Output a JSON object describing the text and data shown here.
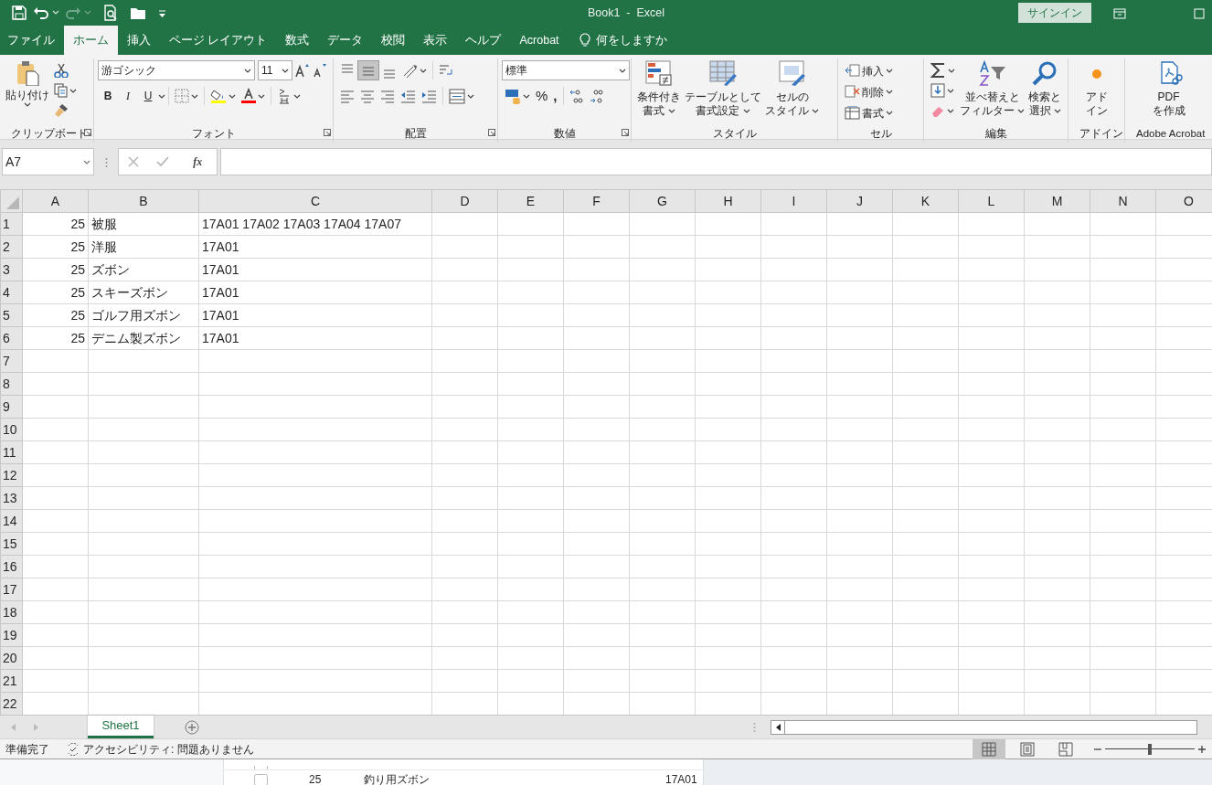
{
  "window": {
    "title": "Book1  -  Excel",
    "sign_in": "サインイン"
  },
  "tabs": [
    {
      "label": "ファイル",
      "selected": false
    },
    {
      "label": "ホーム",
      "selected": true
    },
    {
      "label": "挿入",
      "selected": false
    },
    {
      "label": "ページ レイアウト",
      "selected": false
    },
    {
      "label": "数式",
      "selected": false
    },
    {
      "label": "データ",
      "selected": false
    },
    {
      "label": "校閲",
      "selected": false
    },
    {
      "label": "表示",
      "selected": false
    },
    {
      "label": "ヘルプ",
      "selected": false
    },
    {
      "label": "Acrobat",
      "selected": false
    }
  ],
  "tell_me": "何をしますか",
  "ribbon": {
    "groups": [
      {
        "label": "クリップボード",
        "launcher": true,
        "buttons": [
          {
            "lines": [
              "貼り付け"
            ]
          }
        ]
      },
      {
        "label": "フォント",
        "launcher": true,
        "font_name": "游ゴシック",
        "font_size": "11",
        "buttons": [
          "B",
          "I",
          "U"
        ]
      },
      {
        "label": "配置",
        "launcher": true,
        "align_buttons": [
          {
            "selected": false
          },
          {
            "selected": true
          },
          {
            "selected": false
          }
        ]
      },
      {
        "label": "数値",
        "launcher": true,
        "format": "標準",
        "symbols": [
          "%",
          ","
        ]
      },
      {
        "label": "スタイル",
        "launcher": false,
        "buttons": [
          {
            "lines": [
              "条件付き",
              "書式"
            ]
          },
          {
            "lines": [
              "テーブルとして",
              "書式設定"
            ]
          },
          {
            "lines": [
              "セルの",
              "スタイル"
            ]
          }
        ]
      },
      {
        "label": "セル",
        "launcher": false,
        "buttons": [
          {
            "lines": [
              "挿入"
            ]
          },
          {
            "lines": [
              "削除"
            ]
          },
          {
            "lines": [
              "書式"
            ]
          }
        ]
      },
      {
        "label": "編集",
        "launcher": false,
        "buttons": [
          {
            "lines": [
              "並べ替えと",
              "フィルター"
            ]
          },
          {
            "lines": [
              "検索と",
              "選択"
            ]
          }
        ]
      },
      {
        "label": "アドイン",
        "launcher": false,
        "buttons": [
          {
            "lines": [
              "アド",
              "イン"
            ]
          }
        ]
      },
      {
        "label": "Adobe Acrobat",
        "launcher": false,
        "buttons": [
          {
            "lines": [
              "PDF",
              "を作成"
            ]
          }
        ]
      }
    ]
  },
  "formula_bar": {
    "name_box": "A7",
    "function_label": "fx"
  },
  "table": {
    "columns": [
      "A",
      "B",
      "C",
      "D",
      "E",
      "F",
      "G",
      "H",
      "I",
      "J",
      "K",
      "L",
      "M",
      "N",
      "O"
    ],
    "rows": [
      {
        "num": "1",
        "cells": [
          "25",
          "被服",
          "17A01 17A02 17A03 17A04 17A07"
        ]
      },
      {
        "num": "2",
        "cells": [
          "25",
          "洋服",
          "17A01"
        ]
      },
      {
        "num": "3",
        "cells": [
          "25",
          "ズボン",
          "17A01"
        ]
      },
      {
        "num": "4",
        "cells": [
          "25",
          "スキーズボン",
          "17A01"
        ]
      },
      {
        "num": "5",
        "cells": [
          "25",
          "ゴルフ用ズボン",
          "17A01"
        ]
      },
      {
        "num": "6",
        "cells": [
          "25",
          "デニム製ズボン",
          "17A01"
        ]
      },
      {
        "num": "7",
        "cells": []
      },
      {
        "num": "8",
        "cells": []
      },
      {
        "num": "9",
        "cells": []
      },
      {
        "num": "10",
        "cells": []
      },
      {
        "num": "11",
        "cells": []
      },
      {
        "num": "12",
        "cells": []
      },
      {
        "num": "13",
        "cells": []
      },
      {
        "num": "14",
        "cells": []
      },
      {
        "num": "15",
        "cells": []
      },
      {
        "num": "16",
        "cells": []
      },
      {
        "num": "17",
        "cells": []
      },
      {
        "num": "18",
        "cells": []
      },
      {
        "num": "19",
        "cells": []
      },
      {
        "num": "20",
        "cells": []
      },
      {
        "num": "21",
        "cells": []
      },
      {
        "num": "22",
        "cells": []
      }
    ]
  },
  "sheets": [
    {
      "label": "Sheet1",
      "selected": true
    }
  ],
  "status_bar": {
    "ready": "準備完了",
    "accessibility": "アクセシビリティ: 問題ありません",
    "views": [
      {
        "selected": true
      },
      {
        "selected": false
      },
      {
        "selected": false
      }
    ],
    "zoom": {
      "level": 0.5
    }
  },
  "background_window": {
    "rows": [
      {
        "cells": []
      },
      {
        "cells": [
          "25",
          "釣り用ズボン",
          "17A01"
        ]
      }
    ]
  }
}
